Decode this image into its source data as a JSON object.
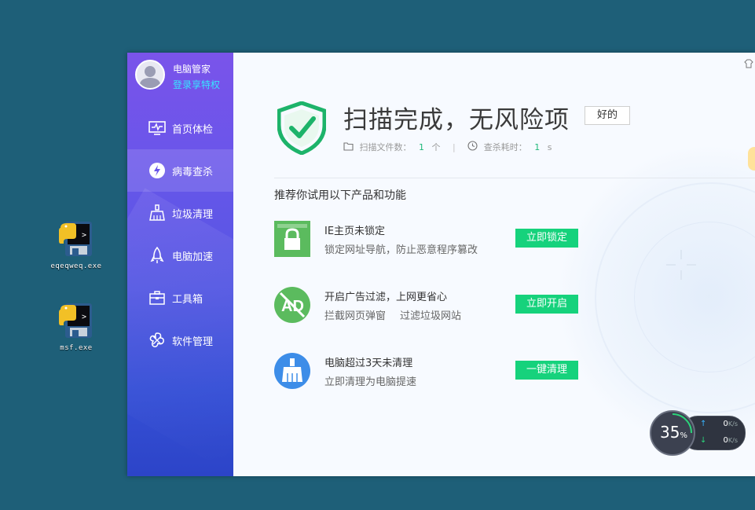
{
  "desktop": {
    "icons": [
      {
        "label": "eqeqweq.exe",
        "icon": "python-exe-icon"
      },
      {
        "label": "msf.exe",
        "icon": "python-exe-icon"
      }
    ]
  },
  "app": {
    "profile": {
      "name": "电脑管家",
      "login": "登录享特权"
    },
    "nav": [
      {
        "label": "首页体检",
        "icon": "monitor-icon"
      },
      {
        "label": "病毒查杀",
        "icon": "virus-scan-icon",
        "active": true
      },
      {
        "label": "垃圾清理",
        "icon": "broom-icon"
      },
      {
        "label": "电脑加速",
        "icon": "rocket-icon"
      },
      {
        "label": "工具箱",
        "icon": "toolbox-icon"
      },
      {
        "label": "软件管理",
        "icon": "software-icon"
      }
    ],
    "result": {
      "title": "扫描完成，无风险项",
      "ok_button": "好的",
      "files_label": "扫描文件数：",
      "files_count": "1",
      "files_unit": "个",
      "time_label": "查杀耗时：",
      "time_value": "1",
      "time_unit": "s"
    },
    "recommend_title": "推荐你试用以下产品和功能",
    "recommendations": [
      {
        "title": "IE主页未锁定",
        "desc": "锁定网址导航，防止恶意程序篡改",
        "desc2": "",
        "button": "立即锁定",
        "icon": "lock-icon",
        "color": "#5bbb5e"
      },
      {
        "title": "开启广告过滤，上网更省心",
        "desc": "拦截网页弹窗",
        "desc2": "过滤垃圾网站",
        "button": "立即开启",
        "icon": "ad-block-icon",
        "color": "#5bbb5e"
      },
      {
        "title": "电脑超过3天未清理",
        "desc": "立即清理为电脑提速",
        "desc2": "",
        "button": "一键清理",
        "icon": "cleanup-broom-icon",
        "color": "#3d8de8"
      }
    ]
  },
  "speed_widget": {
    "percent": "35",
    "percent_unit": "%",
    "upload": "0",
    "download": "0",
    "unit": "K/s"
  }
}
